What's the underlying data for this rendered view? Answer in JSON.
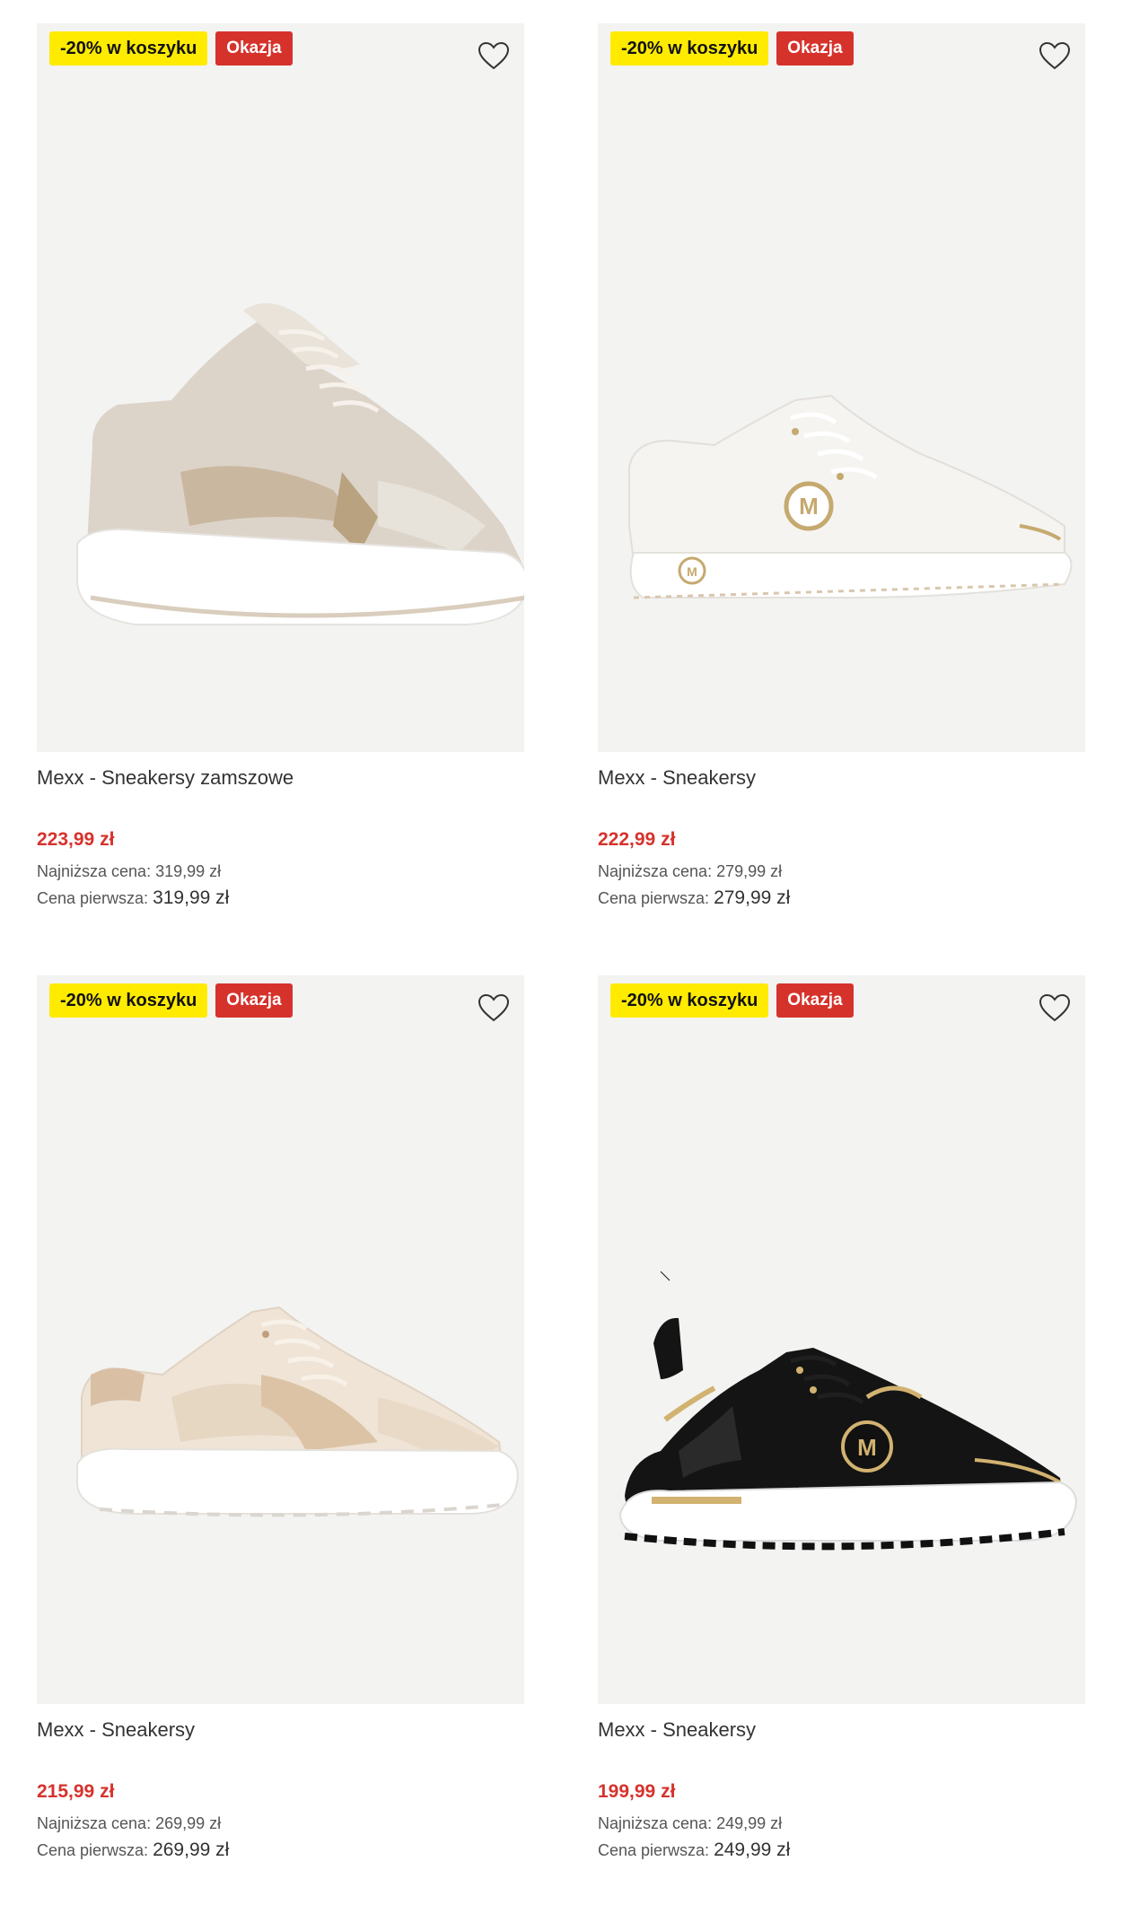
{
  "colors": {
    "promo_bg": "#ffeb00",
    "deal_bg": "#d6322c",
    "price": "#d6322c",
    "tile_bg": "#f3f3f2"
  },
  "products": [
    {
      "badge_promo": "-20% w koszyku",
      "badge_deal": "Okazja",
      "icon": "heart-icon",
      "name": "Mexx - Sneakersy zamszowe",
      "price": "223,99 zł",
      "lowest_label": "Najniższa cena:",
      "lowest_value": "319,99 zł",
      "first_label": "Cena pierwsza:",
      "first_value": "319,99 zł",
      "image": "beige-metallic-chunky-sneaker"
    },
    {
      "badge_promo": "-20% w koszyku",
      "badge_deal": "Okazja",
      "icon": "heart-icon",
      "name": "Mexx - Sneakersy",
      "price": "222,99 zł",
      "lowest_label": "Najniższa cena:",
      "lowest_value": "279,99 zł",
      "first_label": "Cena pierwsza:",
      "first_value": "279,99 zł",
      "image": "white-platform-sneaker-with-gold-logo"
    },
    {
      "badge_promo": "-20% w koszyku",
      "badge_deal": "Okazja",
      "icon": "heart-icon",
      "name": "Mexx - Sneakersy",
      "price": "215,99 zł",
      "lowest_label": "Najniższa cena:",
      "lowest_value": "269,99 zł",
      "first_label": "Cena pierwsza:",
      "first_value": "269,99 zł",
      "image": "cream-beige-running-sneaker"
    },
    {
      "badge_promo": "-20% w koszyku",
      "badge_deal": "Okazja",
      "icon": "heart-icon",
      "name": "Mexx - Sneakersy",
      "price": "199,99 zł",
      "lowest_label": "Najniższa cena:",
      "lowest_value": "249,99 zł",
      "first_label": "Cena pierwsza:",
      "first_value": "249,99 zł",
      "image": "black-gold-sneaker-with-logo"
    }
  ]
}
